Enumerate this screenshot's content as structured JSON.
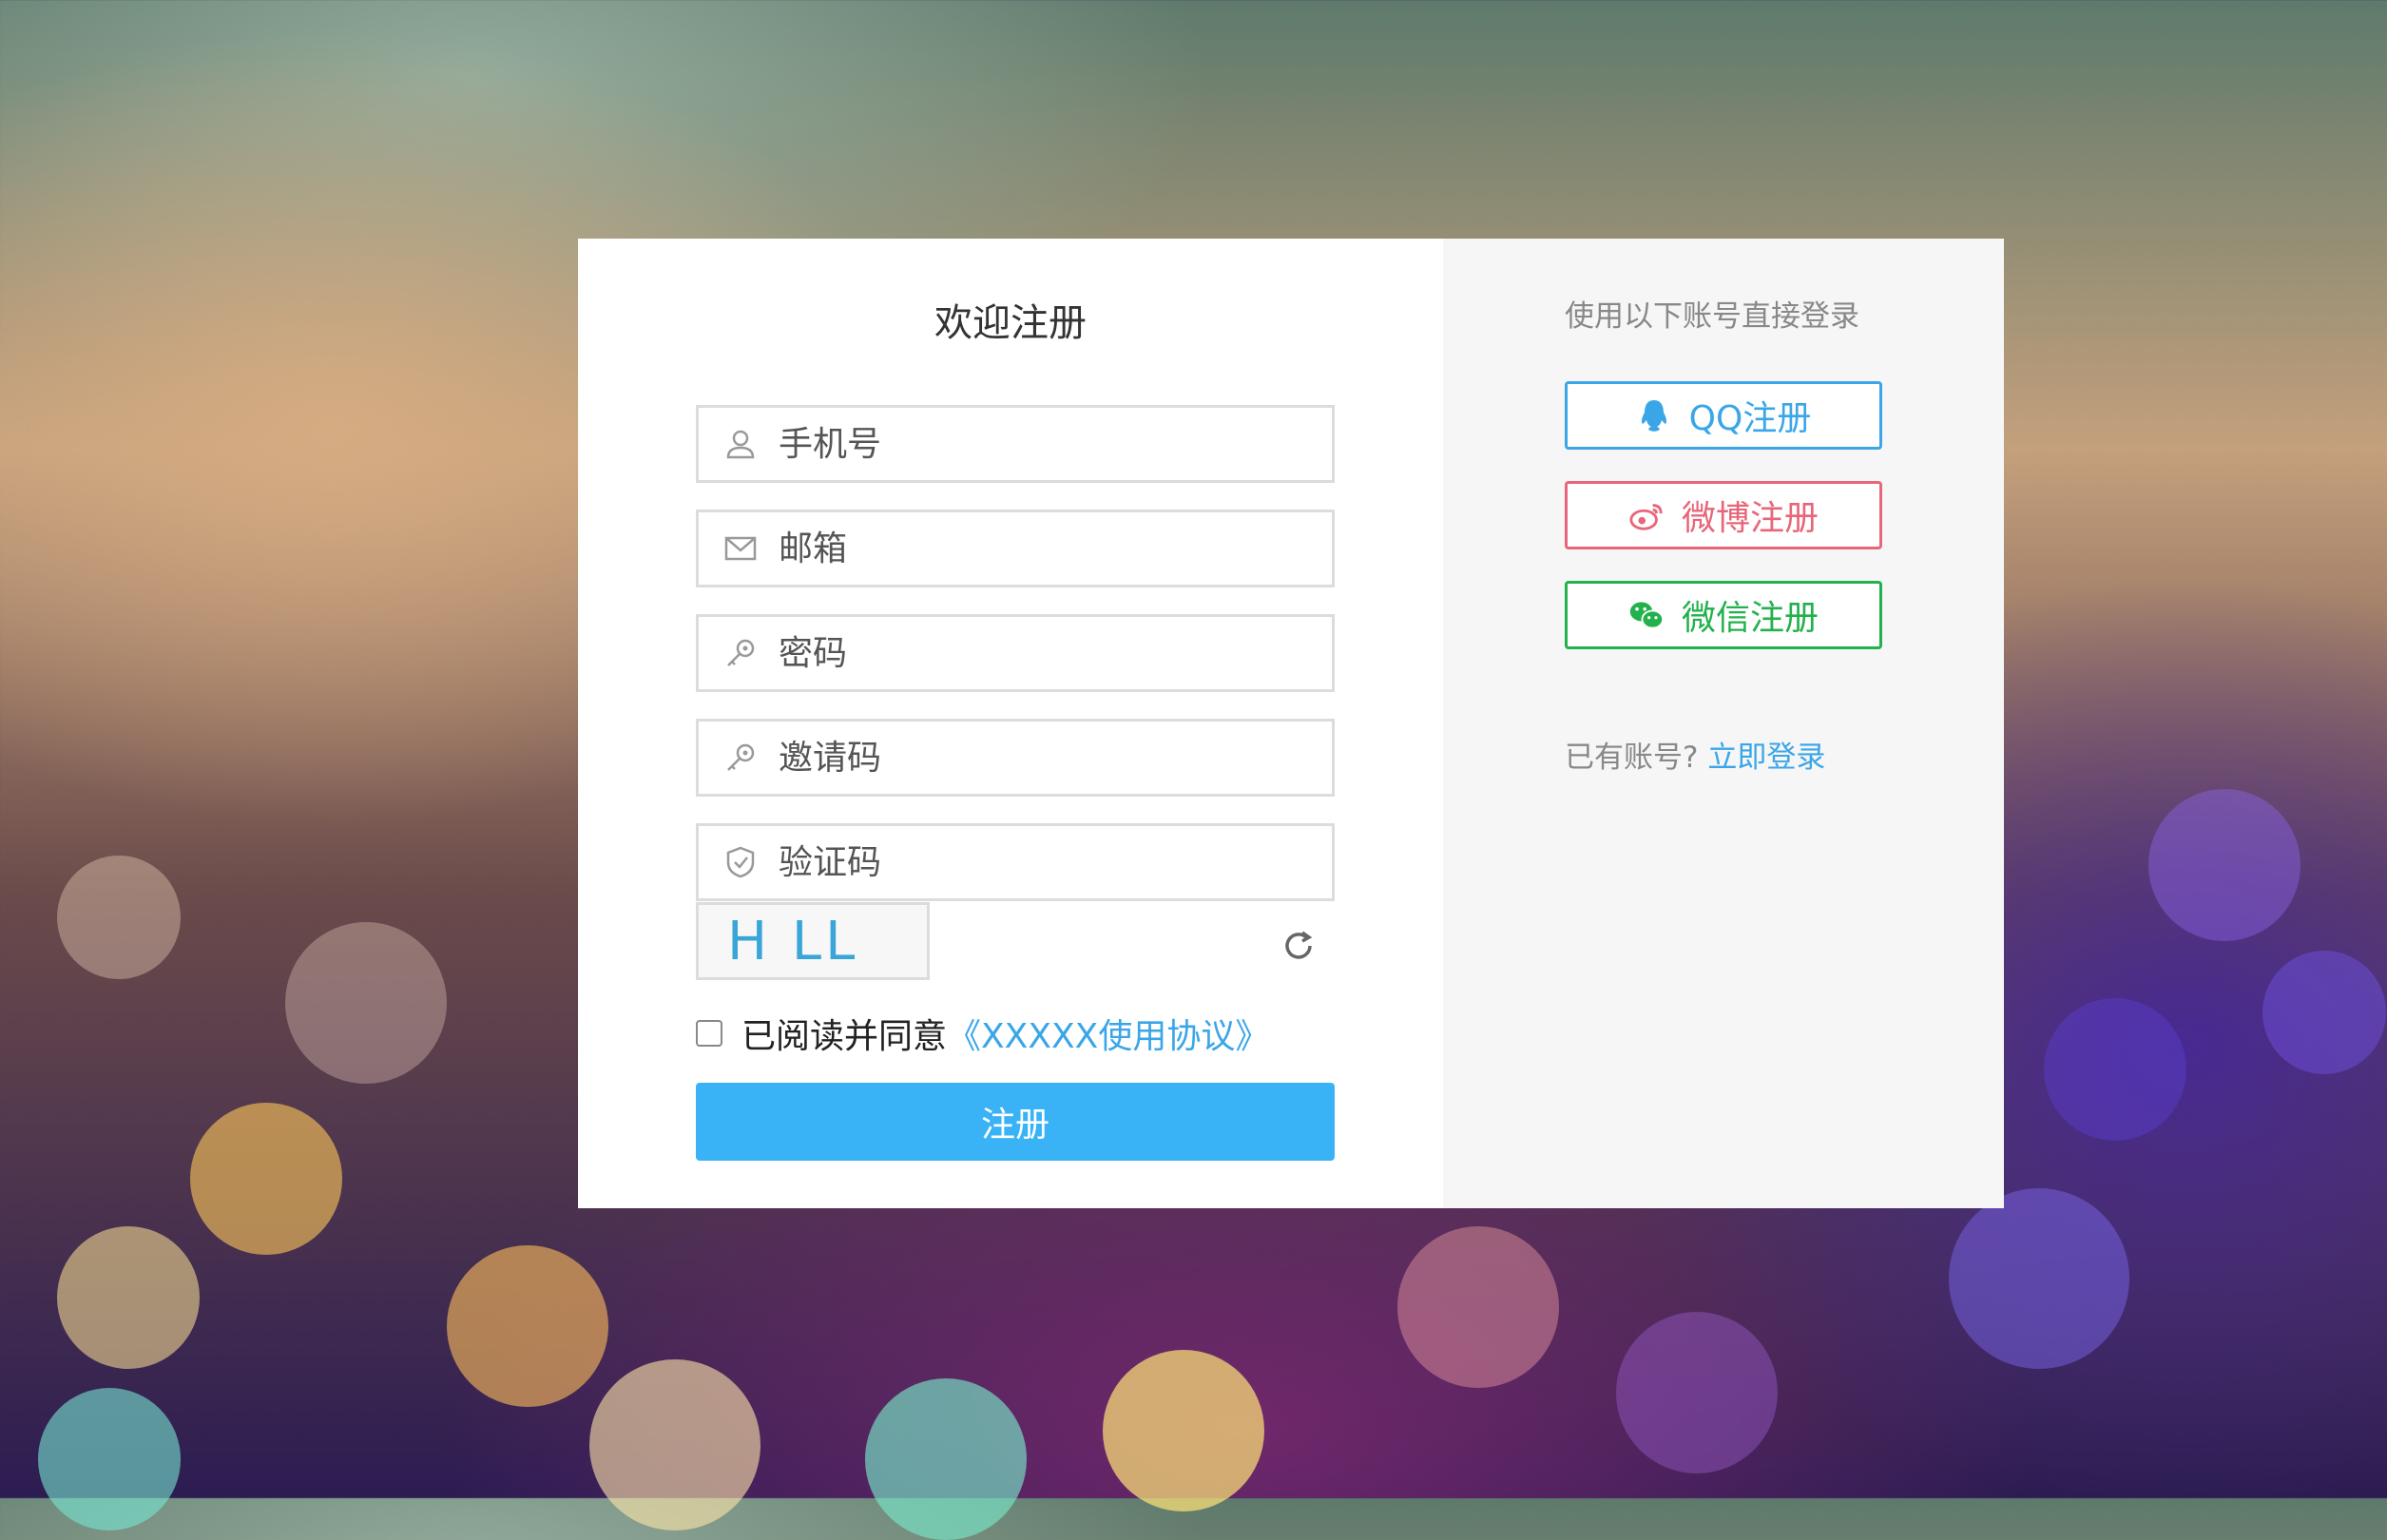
{
  "form": {
    "title": "欢迎注册",
    "phone_placeholder": "手机号",
    "email_placeholder": "邮箱",
    "password_placeholder": "密码",
    "invite_placeholder": "邀请码",
    "captcha_placeholder": "验证码",
    "captcha_image_text": "H LL",
    "agree_text": "已阅读并同意",
    "agreement_link": "《XXXXX使用协议》",
    "submit_label": "注册"
  },
  "social": {
    "title": "使用以下账号直接登录",
    "qq_label": "QQ注册",
    "weibo_label": "微博注册",
    "wechat_label": "微信注册"
  },
  "login": {
    "prompt": "已有账号?",
    "link_label": "立即登录"
  },
  "icons": {
    "phone": "user-icon",
    "email": "envelope-icon",
    "password": "key-icon",
    "invite": "key-icon",
    "captcha": "shield-check-icon",
    "refresh": "refresh-icon",
    "qq": "qq-icon",
    "weibo": "weibo-icon",
    "wechat": "wechat-icon"
  },
  "colors": {
    "primary": "#39b3f6",
    "qq": "#3aa6e8",
    "weibo": "#e8667a",
    "wechat": "#22b14c",
    "link": "#3aa6e8"
  }
}
